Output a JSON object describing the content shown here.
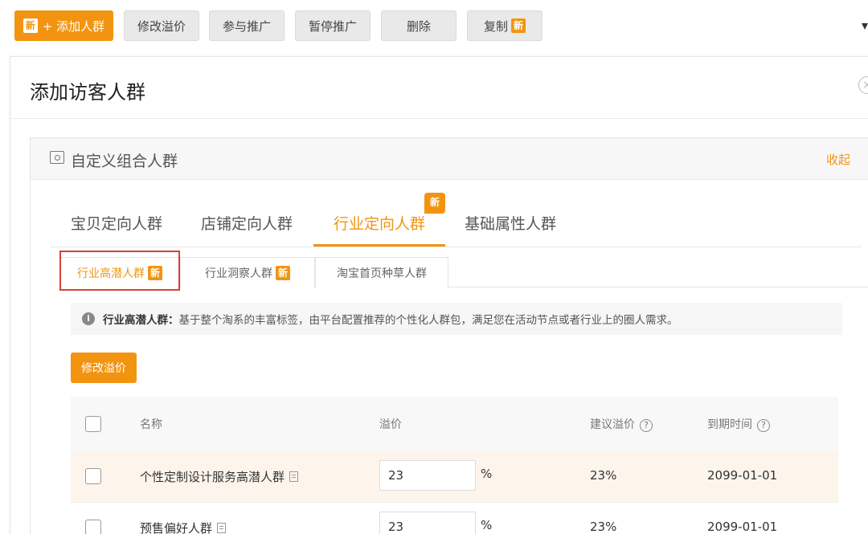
{
  "toolbar": {
    "add_crowd": "+ 添加人群",
    "new_badge": "新",
    "modify_premium": "修改溢价",
    "join_promo": "参与推广",
    "pause_promo": "暂停推广",
    "delete": "删除",
    "copy": "复制"
  },
  "panel": {
    "title": "添加访客人群",
    "close": "×"
  },
  "section": {
    "title": "自定义组合人群",
    "collapse": "收起"
  },
  "tabs": [
    {
      "label": "宝贝定向人群"
    },
    {
      "label": "店铺定向人群"
    },
    {
      "label": "行业定向人群"
    },
    {
      "label": "基础属性人群"
    }
  ],
  "tab_new": "新",
  "subtabs": [
    {
      "label": "行业高潜人群",
      "badge": "新"
    },
    {
      "label": "行业洞察人群",
      "badge": "新"
    },
    {
      "label": "淘宝首页种草人群"
    }
  ],
  "info": {
    "icon": "i",
    "label": "行业高潜人群：",
    "text": "基于整个淘系的丰富标签，由平台配置推荐的个性化人群包，满足您在活动节点或者行业上的圈人需求。"
  },
  "modify_button": "修改溢价",
  "table": {
    "headers": {
      "name": "名称",
      "premium": "溢价",
      "suggested": "建议溢价",
      "expiry": "到期时间"
    },
    "help": "?",
    "rows": [
      {
        "name": "个性定制设计服务高潜人群",
        "premium": "23",
        "unit": "%",
        "suggested": "23%",
        "expiry": "2099-01-01"
      },
      {
        "name": "预售偏好人群",
        "premium": "23",
        "unit": "%",
        "suggested": "23%",
        "expiry": "2099-01-01"
      }
    ]
  },
  "colors": {
    "accent": "#f39410",
    "highlight_border": "#d9403a"
  }
}
